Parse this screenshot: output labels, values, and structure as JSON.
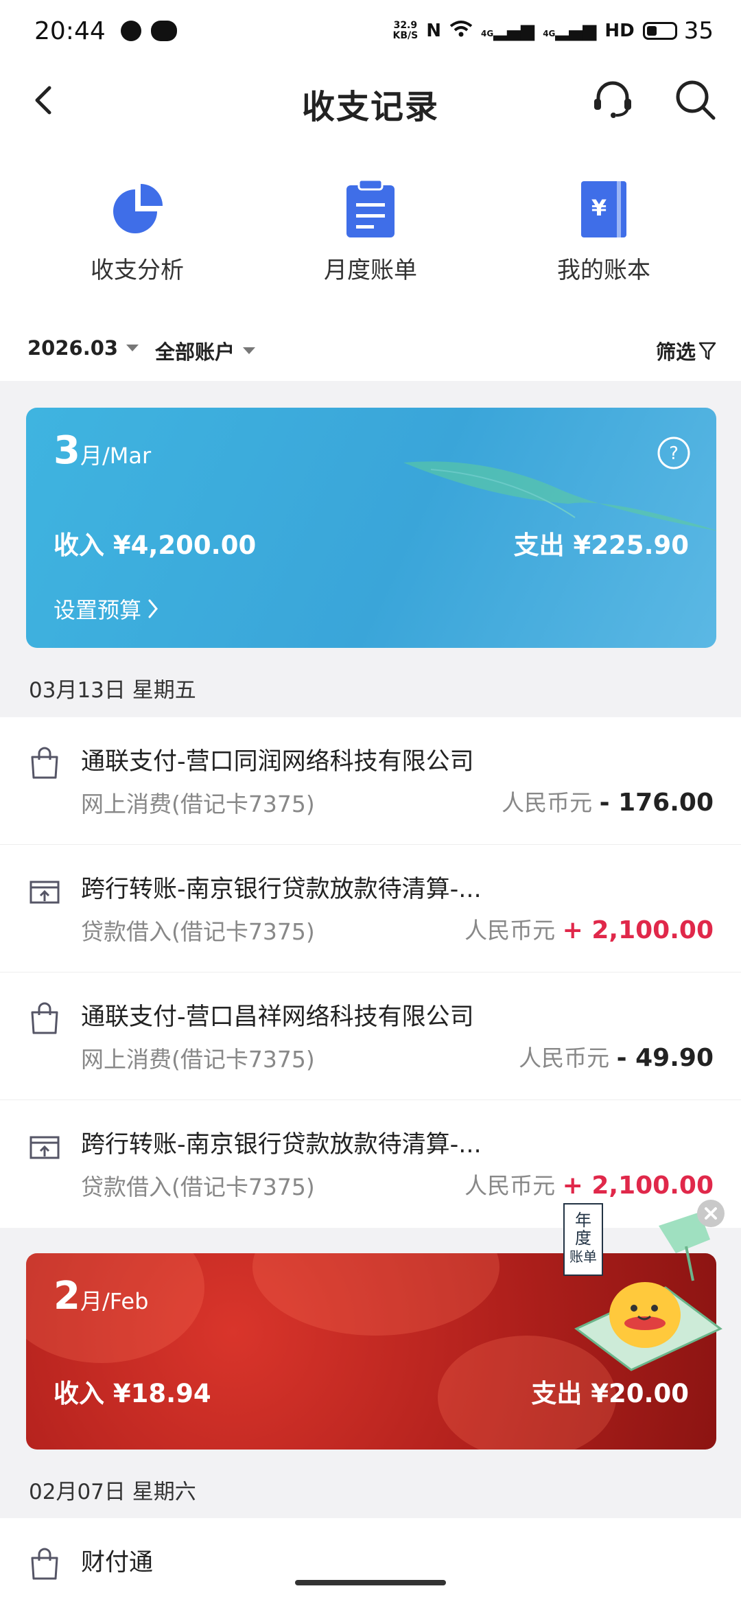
{
  "status_bar": {
    "time": "20:44",
    "net_speed_top": "32.9",
    "net_speed_bottom": "KB/S",
    "signal_1": "4G",
    "signal_2": "4G",
    "hd": "HD",
    "battery": "35"
  },
  "header": {
    "title": "收支记录"
  },
  "quick_actions": [
    {
      "label": "收支分析",
      "icon": "pie-chart-icon",
      "color": "#3f6ee8"
    },
    {
      "label": "月度账单",
      "icon": "clipboard-icon",
      "color": "#3f6ee8"
    },
    {
      "label": "我的账本",
      "icon": "ledger-book-icon",
      "color": "#3f6ee8"
    }
  ],
  "filter": {
    "month": "2026.03",
    "account": "全部账户",
    "filter_label": "筛选"
  },
  "march_card": {
    "month_num": "3",
    "month_text": "月/Mar",
    "income": "收入 ¥4,200.00",
    "expense": "支出 ¥225.90",
    "budget": "设置预算"
  },
  "march_date": "03月13日 星期五",
  "transactions": [
    {
      "title": "通联支付-营口同润网络科技有限公司",
      "sub": "网上消费(借记卡7375)",
      "currency": "人民币元",
      "amount": "- 176.00",
      "type": "expense"
    },
    {
      "title": "跨行转账-南京银行贷款放款待清算-...",
      "sub": "贷款借入(借记卡7375)",
      "currency": "人民币元",
      "amount": "+ 2,100.00",
      "type": "income"
    },
    {
      "title": "通联支付-营口昌祥网络科技有限公司",
      "sub": "网上消费(借记卡7375)",
      "currency": "人民币元",
      "amount": "- 49.90",
      "type": "expense"
    },
    {
      "title": "跨行转账-南京银行贷款放款待清算-...",
      "sub": "贷款借入(借记卡7375)",
      "currency": "人民币元",
      "amount": "+ 2,100.00",
      "type": "income"
    }
  ],
  "feb_card": {
    "month_num": "2",
    "month_text": "月/Feb",
    "income": "收入 ¥18.94",
    "expense": "支出 ¥20.00"
  },
  "feb_date": "02月07日 星期六",
  "feb_partial_title": "财付通",
  "ad": {
    "badge_text": "年度账单"
  },
  "colors": {
    "accent": "#3f6ee8",
    "income": "#e0284a",
    "march_card": "#3aa5d9",
    "feb_card": "#b0201c"
  }
}
